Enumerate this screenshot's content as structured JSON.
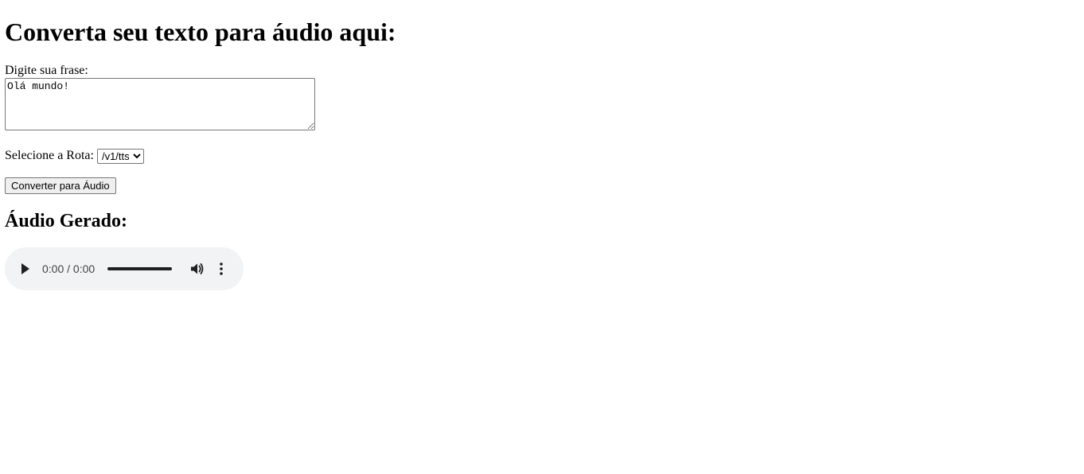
{
  "page": {
    "title": "Converta seu texto para áudio aqui:"
  },
  "form": {
    "phrase_label": "Digite sua frase:",
    "phrase_value": "Olá mundo!",
    "route_label": "Selecione a Rota:",
    "route_selected": "/v1/tts",
    "convert_button": "Converter para Áudio"
  },
  "audio": {
    "title": "Áudio Gerado:",
    "time": "0:00 / 0:00",
    "progress": 0,
    "play_icon": "play-icon",
    "volume_icon": "volume-icon",
    "more_icon": "more-options-icon"
  }
}
